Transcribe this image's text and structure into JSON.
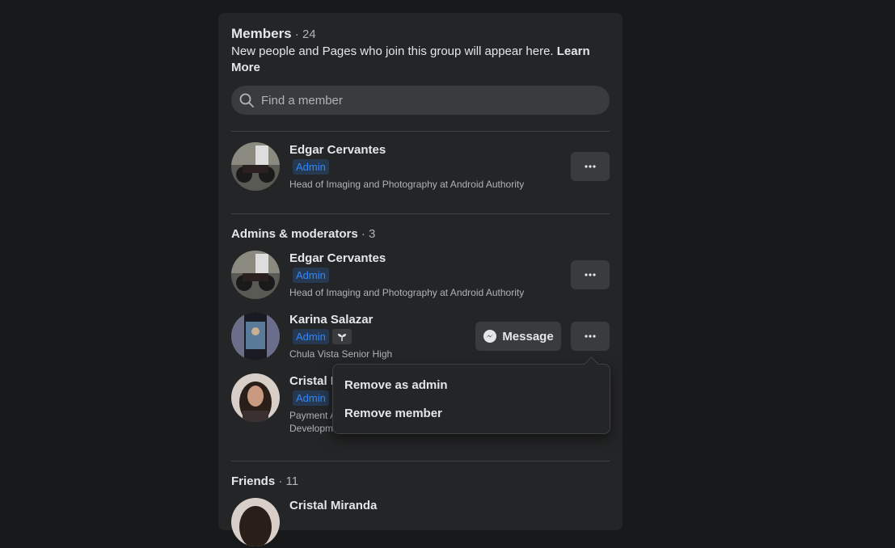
{
  "members_header": {
    "title": "Members",
    "count": " · 24",
    "subtitle": "New people and Pages who join this group will appear here.",
    "learn_more": "Learn More"
  },
  "search": {
    "placeholder": "Find a member"
  },
  "top_member": {
    "name": "Edgar Cervantes",
    "badge": "Admin",
    "description": "Head of Imaging and Photography at Android Authority"
  },
  "admins_section": {
    "title": "Admins & moderators",
    "count": " · 3",
    "members": [
      {
        "name": "Edgar Cervantes",
        "badge": "Admin",
        "description": "Head of Imaging and Photography at Android Authority"
      },
      {
        "name": "Karina Salazar",
        "badge": "Admin",
        "description": "Chula Vista Senior High",
        "message_label": "Message"
      },
      {
        "name": "Cristal M",
        "badge": "Admin",
        "description_line1": "Payment A",
        "description_line2": "Developm"
      }
    ]
  },
  "dropdown": {
    "items": [
      "Remove as admin",
      "Remove member"
    ]
  },
  "friends_section": {
    "title": "Friends",
    "count": " · 11",
    "next_name": "Cristal Miranda"
  },
  "icons": {
    "search": "search-icon",
    "more": "more-dots-icon",
    "messenger": "messenger-icon",
    "new_member": "sprout-icon"
  }
}
